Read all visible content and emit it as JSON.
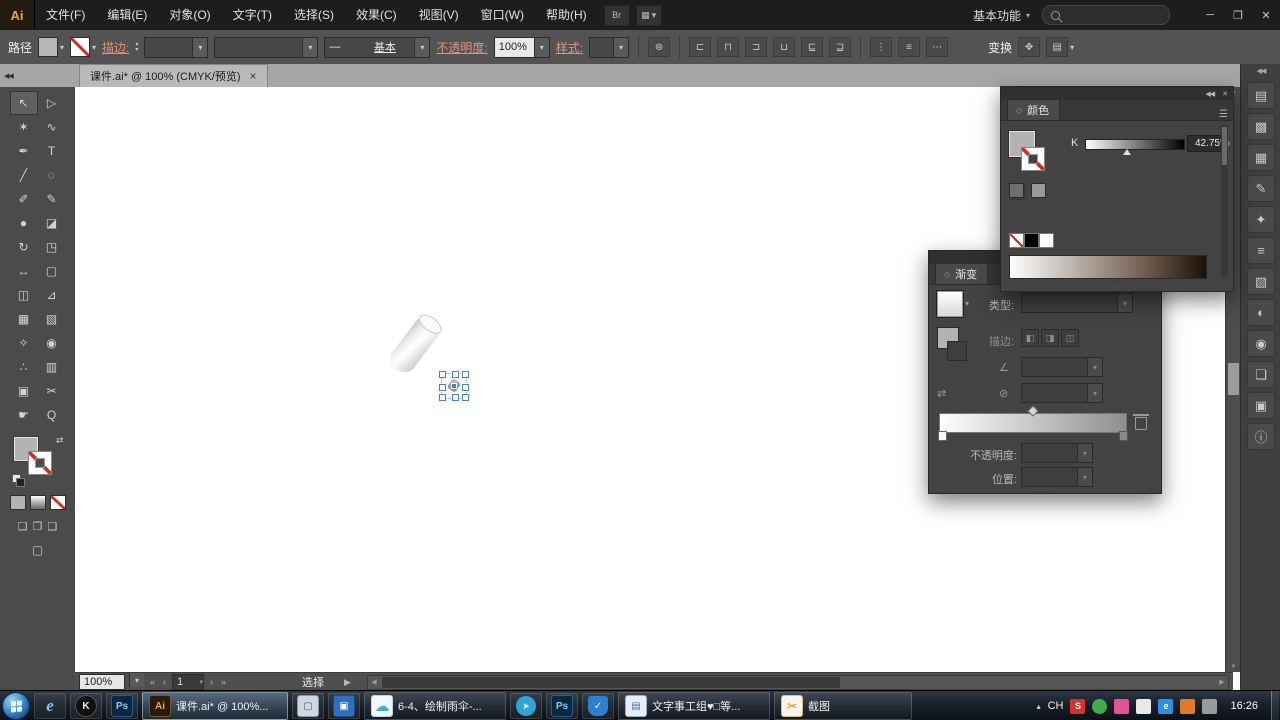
{
  "titlebar": {
    "logo": "Ai",
    "menu": [
      "文件(F)",
      "编辑(E)",
      "对象(O)",
      "文字(T)",
      "选择(S)",
      "效果(C)",
      "视图(V)",
      "窗口(W)",
      "帮助(H)"
    ],
    "workspace": "基本功能"
  },
  "icons": {
    "dropdown": "▾",
    "spin_up": "▴",
    "spin_down": "▾",
    "minimize": "─",
    "restore": "❐",
    "close": "✕",
    "tab_close": "×",
    "collapse_left": "◀◀",
    "panel_collapse": "◀◀",
    "panel_close": "✕",
    "panel_menu": "☰",
    "bridge": "Br",
    "arrange_docs": "▦",
    "recolor": "⊛",
    "swap": "⇄",
    "first": "«",
    "prev": "‹",
    "next": "›",
    "last": "»",
    "left": "◀",
    "right": "▶",
    "up": "▲",
    "down": "▼",
    "angle": "∠",
    "reverse": "⇄",
    "aspect": "⊘",
    "diamond": "◇",
    "chevron_up": "▴",
    "grip": "∙∙∙∙∙"
  },
  "controlbar": {
    "selection_type": "路径",
    "stroke_label": "描边:",
    "stroke_weight": "",
    "brush_line": "—",
    "brush_name": "基本",
    "opacity_label": "不透明度:",
    "opacity_value": "100%",
    "style_label": "样式:",
    "transform_label": "变换",
    "align_icons": [
      "⊏",
      "⊓",
      "⊐",
      "⊔",
      "⊑",
      "⊒"
    ],
    "distribute_icons": [
      "⋮",
      "≡",
      "⋯"
    ],
    "extra_icons": [
      "✥",
      "▤"
    ]
  },
  "document_tab": {
    "title": "课件.ai* @ 100% (CMYK/预览)"
  },
  "tools": [
    {
      "name": "selection",
      "glyph": "↖"
    },
    {
      "name": "direct-selection",
      "glyph": "▷"
    },
    {
      "name": "magic-wand",
      "glyph": "✶"
    },
    {
      "name": "lasso",
      "glyph": "∿"
    },
    {
      "name": "pen",
      "glyph": "✒"
    },
    {
      "name": "type",
      "glyph": "T"
    },
    {
      "name": "line-segment",
      "glyph": "╱"
    },
    {
      "name": "ellipse",
      "glyph": "◌"
    },
    {
      "name": "paintbrush",
      "glyph": "✐"
    },
    {
      "name": "pencil",
      "glyph": "✎"
    },
    {
      "name": "blob-brush",
      "glyph": "●"
    },
    {
      "name": "eraser",
      "glyph": "◪"
    },
    {
      "name": "rotate",
      "glyph": "↻"
    },
    {
      "name": "scale",
      "glyph": "◳"
    },
    {
      "name": "width",
      "glyph": "↔"
    },
    {
      "name": "free-transform",
      "glyph": "▢"
    },
    {
      "name": "shape-builder",
      "glyph": "◫"
    },
    {
      "name": "perspective-grid",
      "glyph": "⊿"
    },
    {
      "name": "mesh",
      "glyph": "▦"
    },
    {
      "name": "gradient",
      "glyph": "▧"
    },
    {
      "name": "eyedropper",
      "glyph": "✧"
    },
    {
      "name": "blend",
      "glyph": "◉"
    },
    {
      "name": "symbol-sprayer",
      "glyph": "∴"
    },
    {
      "name": "column-graph",
      "glyph": "▥"
    },
    {
      "name": "artboard",
      "glyph": "▣"
    },
    {
      "name": "slice",
      "glyph": "✂"
    },
    {
      "name": "hand",
      "glyph": "☛"
    },
    {
      "name": "zoom",
      "glyph": "Q"
    }
  ],
  "toolbar_extras": {
    "modes": [
      "❏",
      "❐",
      "❑"
    ],
    "screen_mode": "▢"
  },
  "statusbar": {
    "zoom": "100%",
    "artboard": "1",
    "status": "选择"
  },
  "panels": {
    "color": {
      "title": "颜色",
      "channel": "K",
      "value": "42.75",
      "unit": "%"
    },
    "gradient": {
      "title": "渐变",
      "type_label": "类型:",
      "stroke_label": "描边:",
      "stroke_buttons": [
        "◧",
        "◨",
        "◫"
      ],
      "opacity_label": "不透明度:",
      "position_label": "位置:"
    }
  },
  "dock": {
    "icons": [
      {
        "name": "color",
        "glyph": "▤"
      },
      {
        "name": "color-guide",
        "glyph": "▩"
      },
      {
        "name": "swatches",
        "glyph": "▦"
      },
      {
        "name": "brushes",
        "glyph": "✎"
      },
      {
        "name": "symbols",
        "glyph": "✦"
      },
      {
        "name": "stroke",
        "glyph": "≡"
      },
      {
        "name": "gradient",
        "glyph": "▧"
      },
      {
        "name": "transparency",
        "glyph": "◐"
      },
      {
        "name": "appearance",
        "glyph": "◉"
      },
      {
        "name": "layers",
        "glyph": "❏"
      },
      {
        "name": "artboards",
        "glyph": "▣"
      },
      {
        "name": "info",
        "glyph": "ⓘ"
      }
    ]
  },
  "taskbar": {
    "quick": [
      {
        "name": "ie",
        "glyph": "e"
      },
      {
        "name": "wps",
        "glyph": "K"
      },
      {
        "name": "photoshop",
        "glyph": "Ps"
      }
    ],
    "mid": [
      {
        "name": "explorer",
        "glyph": "▢"
      },
      {
        "name": "wordpad",
        "glyph": "▣"
      }
    ],
    "after": [
      {
        "name": "messenger",
        "glyph": "➤"
      },
      {
        "name": "photoshop2",
        "glyph": "Ps"
      },
      {
        "name": "security",
        "glyph": "✓"
      }
    ],
    "buttons": [
      {
        "label": "课件.ai* @ 100%...",
        "icon": "Ai"
      },
      {
        "label": "6-4、绘制雨伞-...",
        "icon": "☁"
      },
      {
        "label": "文字事工组♥□等...",
        "icon": "▤"
      },
      {
        "label": "截图",
        "icon": "✂"
      }
    ],
    "tray": {
      "lang": "CH",
      "time": "16:26"
    },
    "tray_icons": [
      {
        "name": "tray-red",
        "glyph": "S",
        "color": "#d3342a"
      },
      {
        "name": "tray-green",
        "glyph": "",
        "color": "#3fae49"
      },
      {
        "name": "tray-pink",
        "glyph": "",
        "color": "#e0559a"
      },
      {
        "name": "tray-white",
        "glyph": "",
        "color": "#e8e8e8"
      },
      {
        "name": "tray-blue",
        "glyph": "e",
        "color": "#2f8fe0"
      },
      {
        "name": "tray-orange",
        "glyph": "",
        "color": "#e07b2a"
      },
      {
        "name": "tray-gray",
        "glyph": "",
        "color": "#9a9a9a"
      }
    ]
  },
  "colors": {
    "selection_blue": "#4e7fc8",
    "ai_orange": "#f0a42e",
    "ps_blue": "#7fd1ff",
    "k_slider_percent": 42.75
  }
}
